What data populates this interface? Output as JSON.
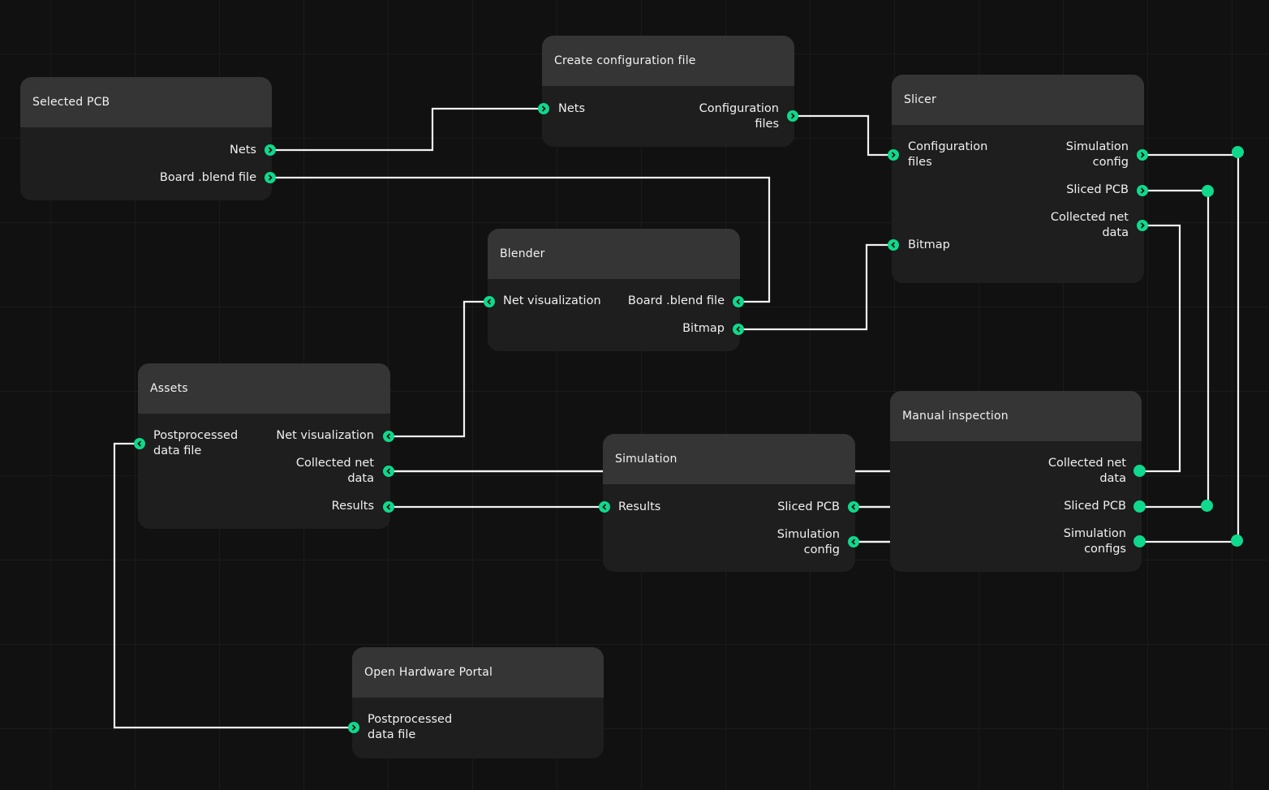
{
  "accent_color": "#0fd98c",
  "nodes": {
    "selected_pcb": {
      "title": "Selected PCB",
      "outputs": [
        "Nets",
        "Board .blend file"
      ]
    },
    "create_config": {
      "title": "Create configuration file",
      "inputs": [
        "Nets"
      ],
      "outputs": [
        "Configuration\nfiles"
      ]
    },
    "slicer": {
      "title": "Slicer",
      "inputs": [
        "Configuration\nfiles",
        "Bitmap"
      ],
      "outputs": [
        "Simulation\nconfig",
        "Sliced PCB",
        "Collected net\ndata"
      ]
    },
    "blender": {
      "title": "Blender",
      "inputs": [
        "Net visualization"
      ],
      "outputs": [
        "Board .blend file",
        "Bitmap"
      ]
    },
    "assets": {
      "title": "Assets",
      "inputs": [
        "Postprocessed\ndata file"
      ],
      "outputs": [
        "Net visualization",
        "Collected net\ndata",
        "Results"
      ]
    },
    "simulation": {
      "title": "Simulation",
      "inputs": [
        "Results"
      ],
      "outputs": [
        "Sliced PCB",
        "Simulation\nconfig"
      ]
    },
    "manual_inspection": {
      "title": "Manual inspection",
      "outputs": [
        "Collected net\ndata",
        "Sliced PCB",
        "Simulation\nconfigs"
      ]
    },
    "open_hardware_portal": {
      "title": "Open Hardware Portal",
      "inputs": [
        "Postprocessed\ndata file"
      ]
    }
  },
  "connections": [
    {
      "from": "Selected PCB / Nets",
      "to": "Create configuration file / Nets"
    },
    {
      "from": "Selected PCB / Board .blend file",
      "to": "Blender / Board .blend file"
    },
    {
      "from": "Create configuration file / Configuration files",
      "to": "Slicer / Configuration files"
    },
    {
      "from": "Blender / Bitmap",
      "to": "Slicer / Bitmap"
    },
    {
      "from": "Blender / Net visualization",
      "to": "Assets / Net visualization"
    },
    {
      "from": "Assets / Postprocessed data file",
      "to": "Open Hardware Portal / Postprocessed data file"
    },
    {
      "from": "Assets / Collected net data",
      "to": "Manual inspection / Collected net data"
    },
    {
      "from": "Assets / Results",
      "to": "Simulation / Results"
    },
    {
      "from": "Simulation / Sliced PCB",
      "to": "Manual inspection / Sliced PCB"
    },
    {
      "from": "Simulation / Simulation config",
      "to": "Manual inspection / Simulation configs"
    },
    {
      "from": "Slicer / Simulation config",
      "to": "Manual inspection / Simulation configs"
    },
    {
      "from": "Slicer / Sliced PCB",
      "to": "Manual inspection / Sliced PCB"
    },
    {
      "from": "Slicer / Collected net data",
      "to": "Manual inspection / Collected net data"
    }
  ]
}
